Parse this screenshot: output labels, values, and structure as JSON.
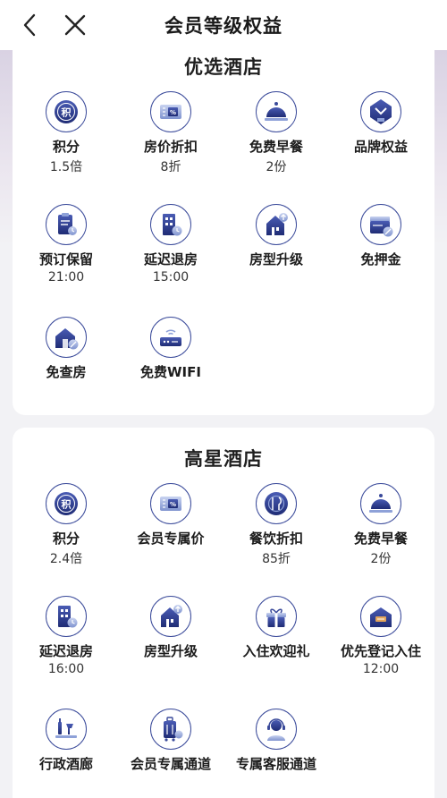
{
  "header": {
    "title": "会员等级权益",
    "back_icon": "chevron-left-icon",
    "close_icon": "close-icon"
  },
  "sections": [
    {
      "title": "优选酒店",
      "items": [
        {
          "label": "积分",
          "sub": "1.5倍",
          "icon": "points-icon"
        },
        {
          "label": "房价折扣",
          "sub": "8折",
          "icon": "discount-coupon-icon"
        },
        {
          "label": "免费早餐",
          "sub": "2份",
          "icon": "breakfast-cloche-icon"
        },
        {
          "label": "品牌权益",
          "sub": "",
          "icon": "brand-badge-icon"
        },
        {
          "label": "预订保留",
          "sub": "21:00",
          "icon": "reservation-hold-icon"
        },
        {
          "label": "延迟退房",
          "sub": "15:00",
          "icon": "late-checkout-icon"
        },
        {
          "label": "房型升级",
          "sub": "",
          "icon": "room-upgrade-icon"
        },
        {
          "label": "免押金",
          "sub": "",
          "icon": "no-deposit-icon"
        },
        {
          "label": "免查房",
          "sub": "",
          "icon": "no-room-check-icon"
        },
        {
          "label": "免费WIFI",
          "sub": "",
          "icon": "wifi-router-icon"
        }
      ]
    },
    {
      "title": "高星酒店",
      "items": [
        {
          "label": "积分",
          "sub": "2.4倍",
          "icon": "points-icon"
        },
        {
          "label": "会员专属价",
          "sub": "",
          "icon": "member-price-coupon-icon"
        },
        {
          "label": "餐饮折扣",
          "sub": "85折",
          "icon": "dining-discount-icon"
        },
        {
          "label": "免费早餐",
          "sub": "2份",
          "icon": "breakfast-cloche-icon"
        },
        {
          "label": "延迟退房",
          "sub": "16:00",
          "icon": "late-checkout-icon"
        },
        {
          "label": "房型升级",
          "sub": "",
          "icon": "room-upgrade-icon"
        },
        {
          "label": "入住欢迎礼",
          "sub": "",
          "icon": "welcome-gift-icon"
        },
        {
          "label": "优先登记入住",
          "sub": "12:00",
          "icon": "priority-checkin-icon"
        },
        {
          "label": "行政酒廊",
          "sub": "",
          "icon": "executive-lounge-icon"
        },
        {
          "label": "会员专属通道",
          "sub": "",
          "icon": "member-lane-luggage-icon"
        },
        {
          "label": "专属客服通道",
          "sub": "",
          "icon": "customer-service-icon"
        }
      ]
    }
  ],
  "colors": {
    "icon_dark": "#2e3d8f",
    "icon_light": "#8ea1d8",
    "accent_orange": "#e2a45b"
  }
}
